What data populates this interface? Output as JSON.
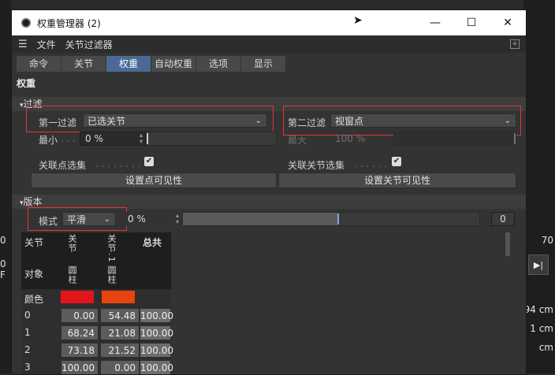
{
  "window": {
    "title": "权重管理器 (2)",
    "controls": [
      "—",
      "☐",
      "✕"
    ]
  },
  "menu": {
    "items": [
      "文件",
      "关节过滤器"
    ]
  },
  "tabs": [
    {
      "label": "命令",
      "active": false
    },
    {
      "label": "关节",
      "active": false
    },
    {
      "label": "权重",
      "active": true
    },
    {
      "label": "自动权重",
      "active": false
    },
    {
      "label": "选项",
      "active": false
    },
    {
      "label": "显示",
      "active": false
    }
  ],
  "heading": "权重",
  "filter": {
    "section_title": "过滤",
    "first_filter_label": "第一过滤",
    "first_filter_value": "已选关节",
    "second_filter_label": "第二过滤",
    "second_filter_value": "视窗点",
    "min_label": "最小",
    "min_value": "0 %",
    "max_label": "最大",
    "max_value": "100 %",
    "assoc_points_label": "关联点选集",
    "assoc_joints_label": "关联关节选集",
    "set_points_btn": "设置点可见性",
    "set_joints_btn": "设置关节可见性"
  },
  "version": {
    "section_title": "版本",
    "mode_label": "模式",
    "mode_value": "平滑",
    "strength_value": "0 %",
    "slider_level": 0.52,
    "count_value": "0"
  },
  "table": {
    "col_header": "关节",
    "object_label": "对象",
    "color_label": "颜色",
    "joint_names": [
      "关节",
      "关节.1"
    ],
    "object_names": [
      "圆柱",
      "圆柱"
    ],
    "total_label": "总共",
    "swatch_colors": [
      "#e0161b",
      "#e8440e"
    ],
    "rows": [
      {
        "idx": "0",
        "a": "0.00",
        "b": "54.48",
        "t": "100.00"
      },
      {
        "idx": "1",
        "a": "68.24",
        "b": "21.08",
        "t": "100.00"
      },
      {
        "idx": "2",
        "a": "73.18",
        "b": "21.52",
        "t": "100.00"
      },
      {
        "idx": "3",
        "a": "100.00",
        "b": "0.00",
        "t": "100.00"
      }
    ]
  },
  "background": {
    "right_values": [
      "70",
      "94 cm",
      "1 cm",
      "cm"
    ],
    "left_values": [
      "0",
      "0 F"
    ]
  }
}
